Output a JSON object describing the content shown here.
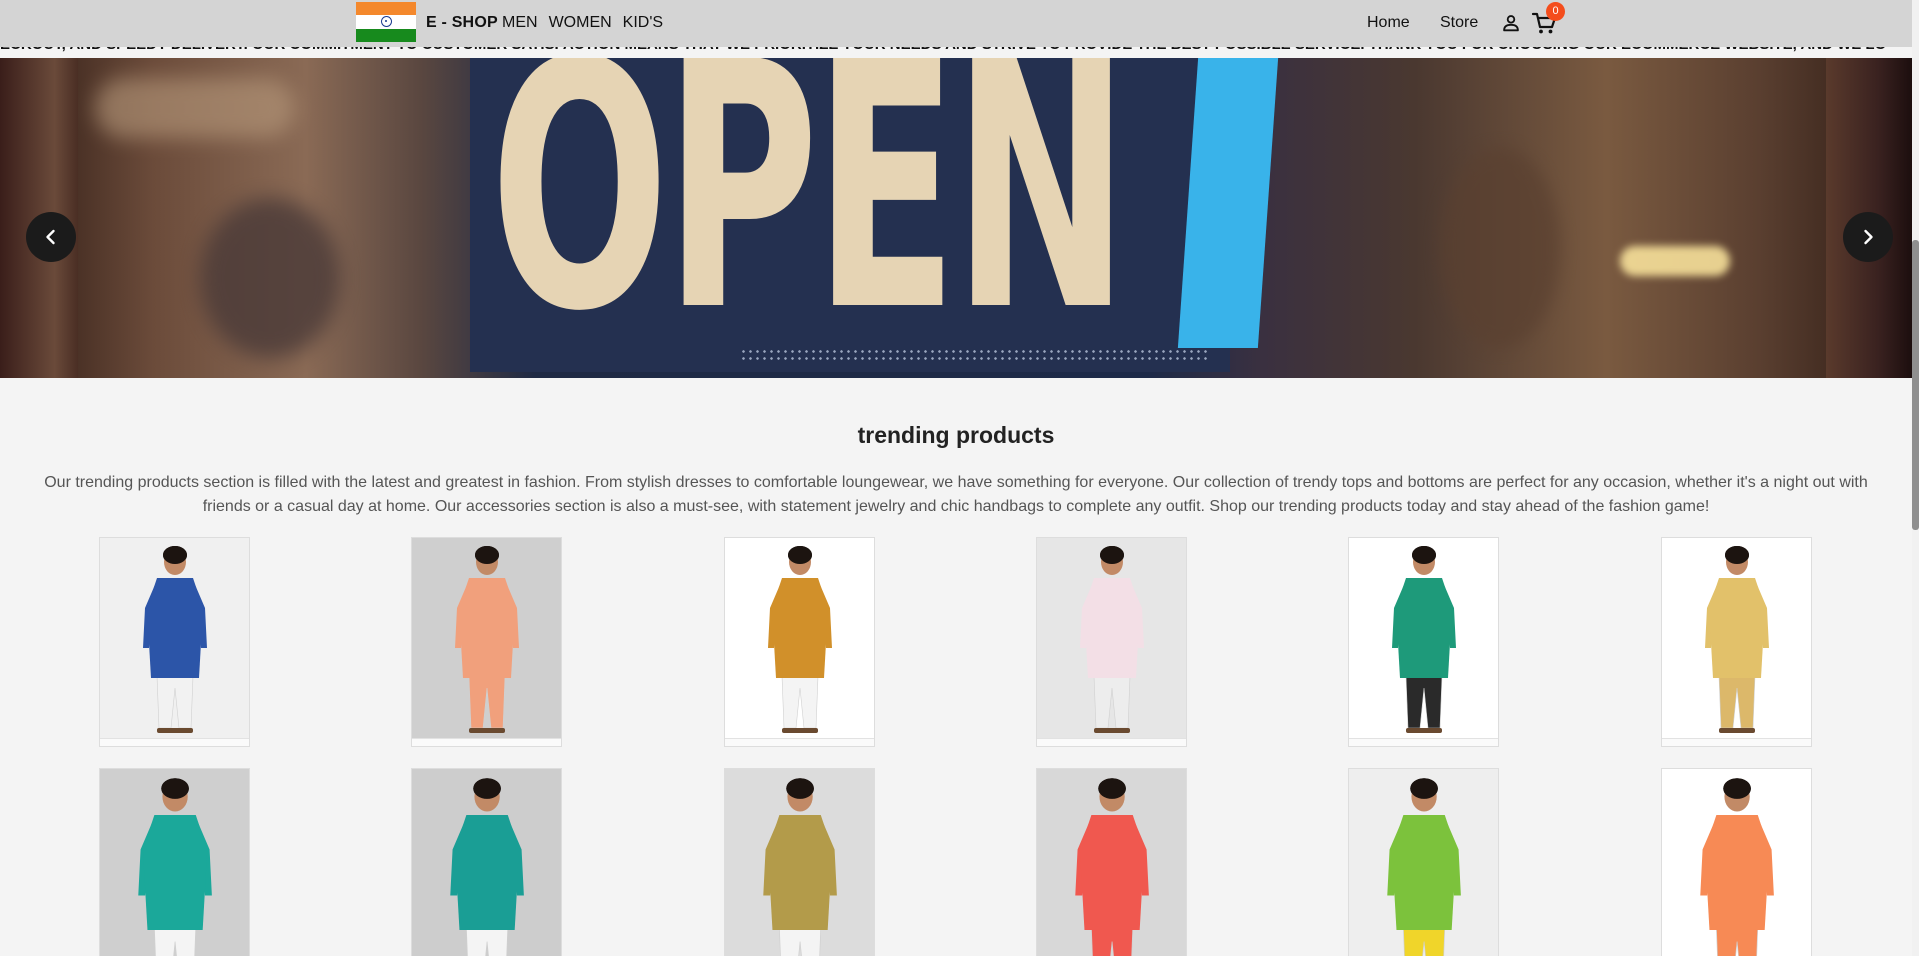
{
  "navbar": {
    "brand": "E - SHOP",
    "left_links": [
      "MEN",
      "WOMEN",
      "KID'S"
    ],
    "home": "Home",
    "store": "Store",
    "cart_count": "0",
    "flag_icon": "india-flag-icon",
    "user_icon": "user-icon",
    "cart_icon": "cart-icon"
  },
  "marquee": {
    "text": "ECKOUT, AND SPEEDY DELIVERY. OUR COMMITMENT TO CUSTOMER SATISFACTION MEANS THAT WE PRIORITIZE YOUR NEEDS AND STRIVE TO PROVIDE THE BEST POSSIBLE SERVICE. THANK YOU FOR CHOOSING OUR ECOMMERCE WEBSITE, AND WE LO"
  },
  "hero": {
    "sign_text": "OPEN",
    "prev_icon": "chevron-left-icon",
    "next_icon": "chevron-right-icon"
  },
  "trending": {
    "title": "trending products",
    "description": "Our trending products section is filled with the latest and greatest in fashion. From stylish dresses to comfortable loungewear, we have something for everyone. Our collection of trendy tops and bottoms are perfect for any occasion, whether it's a night out with friends or a casual day at home. Our accessories section is also a must-see, with statement jewelry and chic handbags to complete any outfit. Shop our trending products today and stay ahead of the fashion game!",
    "products": [
      {
        "name": "blue-printed-kurta",
        "bg": "#f0f0f0",
        "main": "#2c55a8",
        "bottom": "#f2f2f2"
      },
      {
        "name": "peach-palazzo-pants",
        "bg": "#cfcfcf",
        "main": "#f1a07c",
        "bottom": "#f1a07c"
      },
      {
        "name": "mustard-kurta",
        "bg": "#ffffff",
        "main": "#d1902a",
        "bottom": "#f4f4f4"
      },
      {
        "name": "pink-asymmetric-kurta",
        "bg": "#e6e6e6",
        "main": "#f3dfe6",
        "bottom": "#ededed"
      },
      {
        "name": "kids-green-kurta",
        "bg": "#ffffff",
        "main": "#1e9a7a",
        "bottom": "#2a2a2a"
      },
      {
        "name": "kids-gold-kurta-set",
        "bg": "#ffffff",
        "main": "#e2c16a",
        "bottom": "#dcb86a"
      },
      {
        "name": "teal-kurta",
        "bg": "#cfcfcf",
        "main": "#1ba89a",
        "bottom": "#f4f4f4"
      },
      {
        "name": "teal-straight-kurta",
        "bg": "#cdcdcd",
        "main": "#1a9e95",
        "bottom": "#f4f4f4"
      },
      {
        "name": "olive-asymmetric-kurta",
        "bg": "#dcdcdc",
        "main": "#b39b4a",
        "bottom": "#f4f4f4"
      },
      {
        "name": "coral-kurta",
        "bg": "#d8d8d8",
        "main": "#f0584f",
        "bottom": "#f0584f"
      },
      {
        "name": "kids-green-frock",
        "bg": "#eeeeee",
        "main": "#7cc23c",
        "bottom": "#f0d52a"
      },
      {
        "name": "kids-orange-lehenga",
        "bg": "#ffffff",
        "main": "#f78a55",
        "bottom": "#f78a55"
      }
    ]
  }
}
